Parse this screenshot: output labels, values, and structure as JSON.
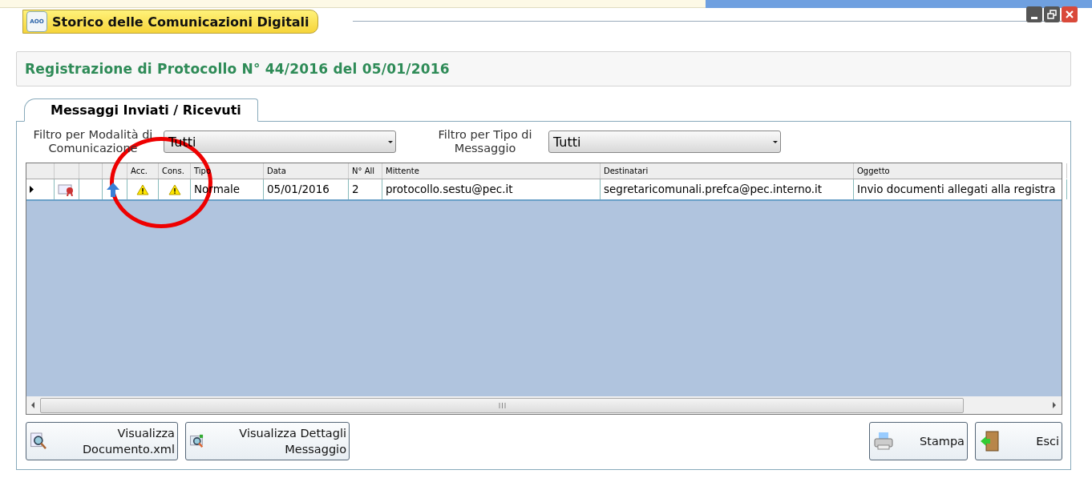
{
  "window": {
    "title": "Storico delle Comunicazioni Digitali",
    "app_badge": "AOO"
  },
  "header": "Registrazione di Protocollo N° 44/2016 del 05/01/2016",
  "tabs": [
    {
      "label": "Messaggi Inviati / Ricevuti",
      "selected": true
    }
  ],
  "filters": [
    {
      "label": "Filtro per Modalità di Comunicazione",
      "value": "Tutti"
    },
    {
      "label": "Filtro per Tipo di Messaggio",
      "value": "Tutti"
    }
  ],
  "table": {
    "columns": [
      "Acc.",
      "Cons.",
      "Tipo",
      "Data",
      "N° All",
      "Mittente",
      "Destinatari",
      "Oggetto"
    ],
    "rows": [
      {
        "selected": true,
        "cells": [
          "",
          "",
          "Normale",
          "05/01/2016",
          "2",
          "protocollo.sestu@pec.it",
          "segretaricomunali.prefca@pec.interno.it",
          "Invio documenti allegati alla registra"
        ]
      }
    ]
  },
  "buttons": [
    {
      "kind": "xml",
      "label": "Visualizza Documento.xml"
    },
    {
      "kind": "details",
      "label": "Visualizza Dettagli Messaggio"
    },
    {
      "kind": "print",
      "label": "Stampa"
    },
    {
      "kind": "exit",
      "label": "Esci"
    }
  ]
}
